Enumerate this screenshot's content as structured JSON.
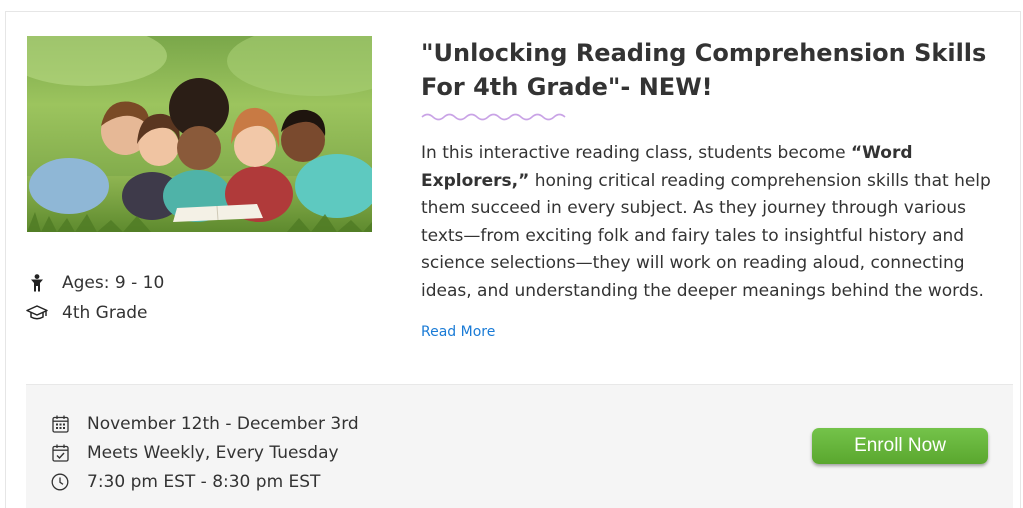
{
  "course": {
    "title": "\"Unlocking Reading Comprehension Skills For 4th Grade\"- NEW!",
    "description_before": "In this interactive reading class, students become ",
    "description_bold": "“Word Explorers,”",
    "description_after": " honing critical reading comprehension skills that help them succeed in every subject. As they journey through various texts—from exciting folk and fairy tales to insightful history and science selections—they will work on reading aloud, connecting ideas, and understanding the deeper meanings behind the words.",
    "read_more_label": "Read More",
    "image_icon": "children-reading-photo"
  },
  "meta": {
    "ages": "Ages: 9 - 10",
    "ages_icon": "child-icon",
    "grade": "4th Grade",
    "grade_icon": "graduation-cap-icon"
  },
  "schedule": {
    "dates": "November 12th - December 3rd",
    "dates_icon": "calendar-icon",
    "frequency": "Meets Weekly, Every Tuesday",
    "frequency_icon": "calendar-check-icon",
    "time": "7:30 pm EST - 8:30 pm EST",
    "time_icon": "clock-icon",
    "enroll_label": "Enroll Now"
  },
  "colors": {
    "accent_squiggle": "#c9a3e6",
    "link": "#1a7bd6",
    "enroll_button": "#66b53c",
    "schedule_bg": "#f5f5f5"
  }
}
